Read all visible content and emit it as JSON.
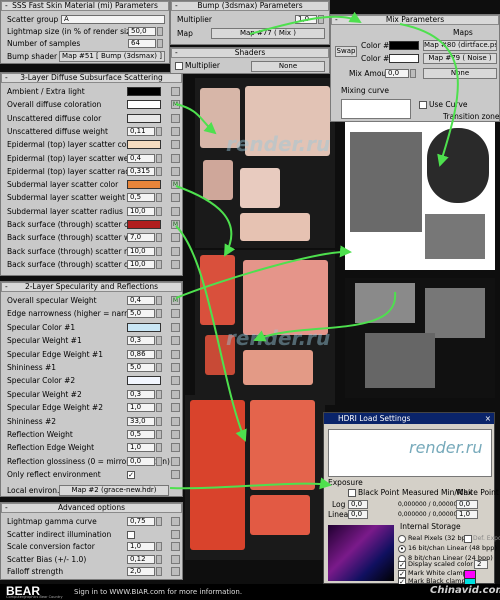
{
  "sss": {
    "title": "SSS Fast Skin Material (mi) Parameters",
    "scatter_group_label": "Scatter group",
    "scatter_group_value": "A",
    "lightmap_label": "Lightmap size (in % of render size)",
    "lightmap_value": "50,0",
    "samples_label": "Number of samples",
    "samples_value": "64",
    "bump_label": "Bump shader",
    "bump_value": "Map #51  [ Bump (3dsmax) ]"
  },
  "diffuse": {
    "title": "3-Layer Diffuse Subsurface Scattering",
    "rows": [
      {
        "label": "Ambient / Extra light",
        "kind": "swatch",
        "color": "#000000"
      },
      {
        "label": "Overall diffuse coloration",
        "kind": "swatch",
        "color": "#ffffff",
        "map": "M"
      },
      {
        "label": "Unscattered diffuse color",
        "kind": "swatch",
        "color": "#e8e8e8"
      },
      {
        "label": "Unscattered diffuse weight",
        "kind": "value",
        "value": "0,11"
      },
      {
        "label": "Epidermal (top) layer scatter color",
        "kind": "swatch",
        "color": "#f6dcc0"
      },
      {
        "label": "Epidermal (top) layer scatter weight",
        "kind": "value",
        "value": "0,4"
      },
      {
        "label": "Epidermal (top) layer scatter radius",
        "kind": "value",
        "value": "0,315"
      },
      {
        "label": "Subdermal layer scatter color",
        "kind": "swatch",
        "color": "#e8853a",
        "map": "M"
      },
      {
        "label": "Subdermal layer scatter weight",
        "kind": "value",
        "value": "0,5"
      },
      {
        "label": "Subdermal layer scatter radius",
        "kind": "value",
        "value": "10,0"
      },
      {
        "label": "Back surface (through) scatter color",
        "kind": "swatch",
        "color": "#b01e1e",
        "map": "M"
      },
      {
        "label": "Back surface (through) scatter weight",
        "kind": "value",
        "value": "7,0"
      },
      {
        "label": "Back surface (through) scatter radius",
        "kind": "value",
        "value": "10,0"
      },
      {
        "label": "Back surface (through) scatter depth",
        "kind": "value",
        "value": "10,0"
      }
    ]
  },
  "specular": {
    "title": "2-Layer Specularity and Reflections",
    "rows": [
      {
        "label": "Overall specular Weight",
        "kind": "value",
        "value": "0,4",
        "map": "M"
      },
      {
        "label": "Edge narrowness (higher = narrower)",
        "kind": "value",
        "value": "5,0"
      },
      {
        "label": "Specular Color #1",
        "kind": "swatch",
        "color": "#c9e6f5"
      },
      {
        "label": "Specular Weight #1",
        "kind": "value",
        "value": "0,3"
      },
      {
        "label": "Specular Edge Weight #1",
        "kind": "value",
        "value": "0,86"
      },
      {
        "label": "Shininess #1",
        "kind": "value",
        "value": "5,0"
      },
      {
        "label": "Specular Color #2",
        "kind": "swatch",
        "color": "#f2f6ff"
      },
      {
        "label": "Specular Weight #2",
        "kind": "value",
        "value": "0,3"
      },
      {
        "label": "Specular Edge Weight #2",
        "kind": "value",
        "value": "1,0"
      },
      {
        "label": "Shininess #2",
        "kind": "value",
        "value": "33,0"
      },
      {
        "label": "Reflection Weight",
        "kind": "value",
        "value": "0,5"
      },
      {
        "label": "Reflection Edge Weight",
        "kind": "value",
        "value": "1,0"
      },
      {
        "label": "Reflection glossiness (0 = mirror reflection)",
        "kind": "value",
        "value": "0,0"
      },
      {
        "label": "Only reflect environment",
        "kind": "check",
        "value": "✓"
      }
    ],
    "local_env_label": "Local environ.",
    "local_env_value": "Map #2 (grace-new.hdr)"
  },
  "advanced": {
    "title": "Advanced options",
    "rows": [
      {
        "label": "Lightmap gamma curve",
        "kind": "value",
        "value": "0,75"
      },
      {
        "label": "Scatter indirect illumination",
        "kind": "check",
        "value": ""
      },
      {
        "label": "Scale conversion factor",
        "kind": "value",
        "value": "1,0"
      },
      {
        "label": "Scatter Bias (+/- 1.0)",
        "kind": "value",
        "value": "0,12"
      },
      {
        "label": "Falloff strength",
        "kind": "value",
        "value": "2,0"
      }
    ]
  },
  "bump": {
    "title": "Bump (3dsmax) Parameters",
    "multiplier_label": "Multiplier",
    "multiplier_value": "1,0",
    "map_label": "Map",
    "map_value": "Map #77  ( Mix )"
  },
  "shaders": {
    "title": "Shaders",
    "multiplier_label": "Multiplier",
    "none_label": "None"
  },
  "mix": {
    "title": "Mix Parameters",
    "maps_label": "Maps",
    "swap_label": "Swap",
    "color1_label": "Color #1",
    "color1_map": "Map #80 (dirtface.psd)",
    "color2_label": "Color #2",
    "color2_map": "Map #79  ( Noise )",
    "mix_amount_label": "Mix Amount:",
    "mix_amount_value": "0,0",
    "none_label": "None",
    "mixing_curve_label": "Mixing curve",
    "use_curve_label": "Use Curve",
    "transition_label": "Transition zone:"
  },
  "hdri": {
    "title": "HDRI Load Settings",
    "exposure_label": "Exposure",
    "black_point_label": "Black Point",
    "measured_label": "Measured Min/Max",
    "white_point_label": "White Point",
    "log_label": "Log",
    "log_value": "0,0",
    "linear_label": "Linear",
    "linear_value": "0,0",
    "meas_min": "0,000000 / 0,000000",
    "meas_max": "0,000000 / 0,000000",
    "wp1": "0,0",
    "wp2": "1,0",
    "internal_label": "Internal Storage",
    "opt1": "Real Pixels (32 bpp)",
    "opt1b": "Def. Exposure",
    "opt2": "16 bit/chan Linear (48 bpp)",
    "opt3": "8 bit/chan Linear (24 bpp)",
    "display_scaled": "Display scaled color by",
    "display_val": "2",
    "mark_white": "Mark White clamp",
    "mark_black": "Mark Black clamp",
    "watermark": "render.ru"
  },
  "watermarks": {
    "site": "render.ru"
  },
  "footer": {
    "logo": "BEAR",
    "logo_sub": "Computergraphics Bear Country",
    "signin": "Sign in to WWW.BIAR.com for more information.",
    "chinavid": "Chinavid.com"
  },
  "colors": {
    "arrow": "#4ee04e",
    "panel": "#c9c9c9",
    "accent_pink": "#ff00ff"
  }
}
